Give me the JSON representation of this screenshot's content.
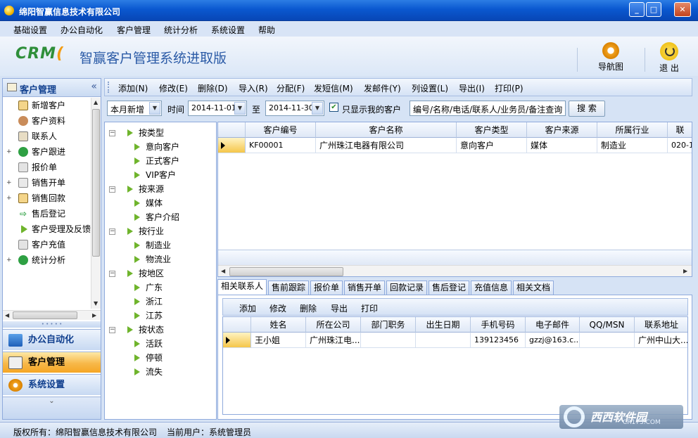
{
  "window": {
    "title": "绵阳智赢信息技术有限公司"
  },
  "menu": [
    "基础设置",
    "办公自动化",
    "客户管理",
    "统计分析",
    "系统设置",
    "帮助"
  ],
  "header": {
    "logo_text": "CRM",
    "app_title": "智赢客户管理系统进取版",
    "nav_label": "导航图",
    "exit_label": "退 出"
  },
  "left_panel": {
    "title": "客户管理",
    "items": [
      {
        "label": "新增客户",
        "expandable": false
      },
      {
        "label": "客户资料",
        "expandable": false
      },
      {
        "label": "联系人",
        "expandable": false
      },
      {
        "label": "客户跟进",
        "expandable": true
      },
      {
        "label": "报价单",
        "expandable": false
      },
      {
        "label": "销售开单",
        "expandable": true
      },
      {
        "label": "销售回款",
        "expandable": true
      },
      {
        "label": "售后登记",
        "expandable": false
      },
      {
        "label": "客户受理及反馈",
        "expandable": false
      },
      {
        "label": "客户充值",
        "expandable": false
      },
      {
        "label": "统计分析",
        "expandable": true
      }
    ],
    "modules": [
      {
        "label": "办公自动化",
        "active": false
      },
      {
        "label": "客户管理",
        "active": true
      },
      {
        "label": "系统设置",
        "active": false
      }
    ]
  },
  "toolbar": [
    "添加(N)",
    "修改(E)",
    "删除(D)",
    "导入(R)",
    "分配(F)",
    "发短信(M)",
    "发邮件(Y)",
    "列设置(L)",
    "导出(I)",
    "打印(P)"
  ],
  "filter": {
    "period": "本月新增",
    "time_label": "时间",
    "date_from": "2014-11-01",
    "to_label": "至",
    "date_to": "2014-11-30",
    "only_mine": "只显示我的客户",
    "search_value": "编号/名称/电话/联系人/业务员/备注查询",
    "search_button": "搜 索"
  },
  "tree": [
    {
      "label": "按类型",
      "children": [
        "意向客户",
        "正式客户",
        "VIP客户"
      ]
    },
    {
      "label": "按来源",
      "children": [
        "媒体",
        "客户介绍"
      ]
    },
    {
      "label": "按行业",
      "children": [
        "制造业",
        "物流业"
      ]
    },
    {
      "label": "按地区",
      "children": [
        "广东",
        "浙江",
        "江苏"
      ]
    },
    {
      "label": "按状态",
      "children": [
        "活跃",
        "停顿",
        "流失"
      ]
    }
  ],
  "customer_grid": {
    "columns": [
      "客户编号",
      "客户名称",
      "客户类型",
      "客户来源",
      "所属行业",
      "联"
    ],
    "rows": [
      [
        "KF00001",
        "广州珠江电器有限公司",
        "意向客户",
        "媒体",
        "制造业",
        "020-1"
      ]
    ]
  },
  "tabs": [
    "相关联系人",
    "售前跟踪",
    "报价单",
    "销售开单",
    "回款记录",
    "售后登记",
    "充值信息",
    "相关文档"
  ],
  "sub_toolbar": [
    "添加",
    "修改",
    "删除",
    "导出",
    "打印"
  ],
  "contact_grid": {
    "columns": [
      "姓名",
      "所在公司",
      "部门职务",
      "出生日期",
      "手机号码",
      "电子邮件",
      "QQ/MSN",
      "联系地址"
    ],
    "rows": [
      [
        "王小姐",
        "广州珠江电...",
        "",
        "",
        "139123456",
        "gzzj@163.c...",
        "",
        "广州中山大..."
      ]
    ]
  },
  "status": {
    "copyright": "版权所有：绵阳智赢信息技术有限公司",
    "user": "当前用户：系统管理员"
  },
  "watermark": {
    "text": "西西软件园",
    "url": "CR173.COM"
  },
  "colors": {
    "titlebar": "#0a58d0",
    "active_module": "#f5a623",
    "tree_arrow": "#6fb42c"
  }
}
